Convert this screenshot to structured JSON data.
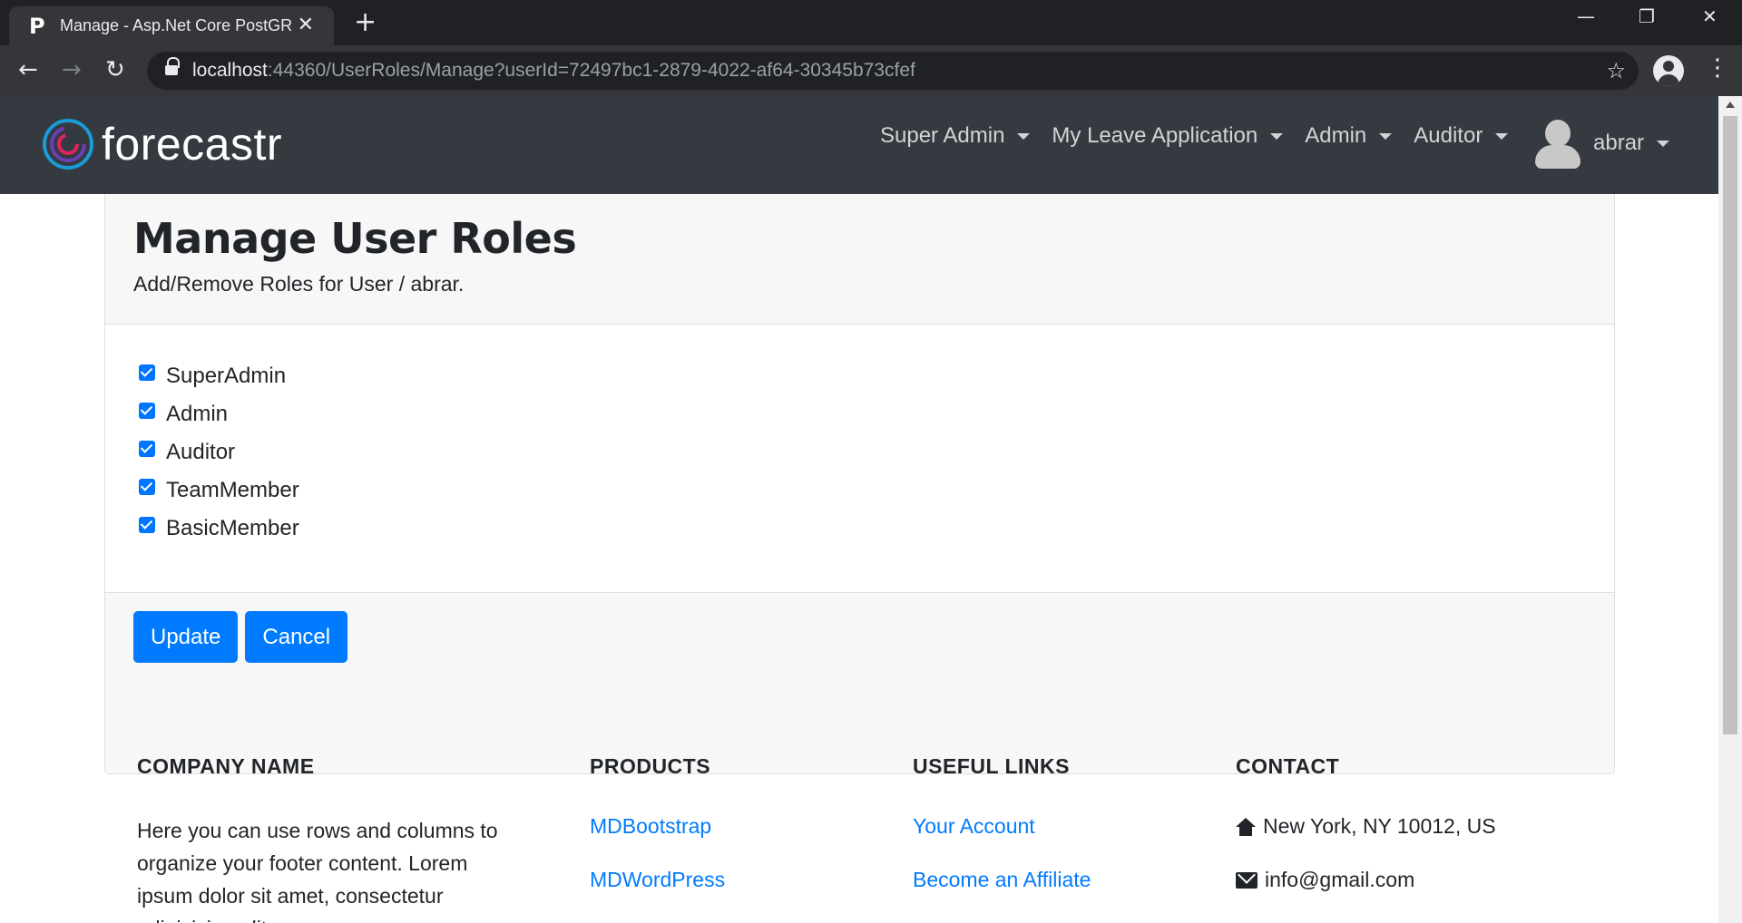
{
  "browser": {
    "tab_title": "Manage - Asp.Net Core PostGRE",
    "tab_favicon": "P",
    "url_host": "localhost",
    "url_rest": ":44360/UserRoles/Manage?userId=72497bc1-2879-4022-af64-30345b73cfef"
  },
  "navbar": {
    "brand": "forecastr",
    "menus": [
      {
        "label": "Super Admin"
      },
      {
        "label": "My Leave Application"
      },
      {
        "label": "Admin"
      },
      {
        "label": "Auditor"
      }
    ],
    "user": "abrar"
  },
  "card": {
    "title": "Manage User Roles",
    "subtitle": "Add/Remove Roles for User / abrar.",
    "roles": [
      {
        "label": "SuperAdmin",
        "checked": true
      },
      {
        "label": "Admin",
        "checked": true
      },
      {
        "label": "Auditor",
        "checked": true
      },
      {
        "label": "TeamMember",
        "checked": true
      },
      {
        "label": "BasicMember",
        "checked": true
      }
    ],
    "update_label": "Update",
    "cancel_label": "Cancel"
  },
  "footer": {
    "company": {
      "heading": "COMPANY NAME",
      "text": "Here you can use rows and columns to organize your footer content. Lorem ipsum dolor sit amet, consectetur adipisicing elit."
    },
    "products": {
      "heading": "PRODUCTS",
      "links": [
        "MDBootstrap",
        "MDWordPress"
      ]
    },
    "useful_links": {
      "heading": "USEFUL LINKS",
      "links": [
        "Your Account",
        "Become an Affiliate"
      ]
    },
    "contact": {
      "heading": "CONTACT",
      "address": "New York, NY 10012, US",
      "email": "info@gmail.com"
    }
  },
  "colors": {
    "navbar_bg": "#343a40",
    "primary": "#007bff",
    "checkbox": "#0075ff"
  }
}
